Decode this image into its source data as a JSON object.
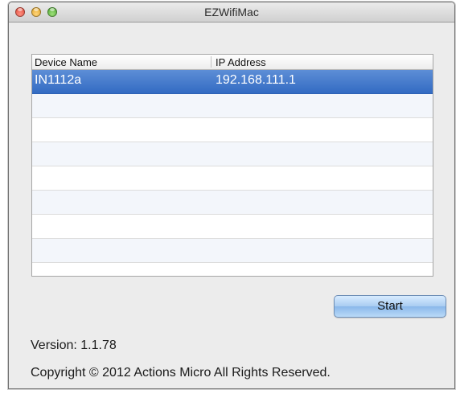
{
  "window": {
    "title": "EZWifiMac",
    "buttons": {
      "close": "close",
      "minimize": "minimize",
      "zoom": "zoom"
    }
  },
  "table": {
    "columns": [
      "Device Name",
      "IP Address"
    ],
    "rows": [
      {
        "device_name": "IN1112a",
        "ip_address": "192.168.111.1",
        "selected": true
      }
    ],
    "selection_color": "#3d78cf"
  },
  "actions": {
    "start_label": "Start"
  },
  "footer": {
    "version": "Version:  1.1.78",
    "copyright": "Copyright © 2012 Actions Micro All Rights Reserved."
  }
}
